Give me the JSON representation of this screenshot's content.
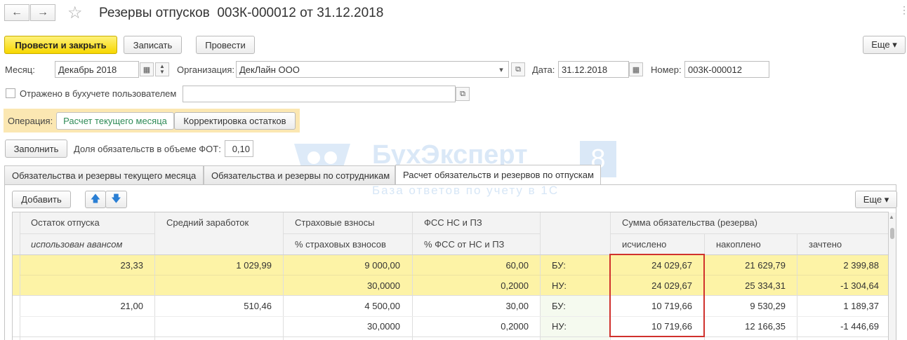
{
  "window": {
    "title": "Резервы отпусков  003К-000012 от 31.12.2018",
    "back_icon": "←",
    "forward_icon": "→",
    "star_icon": "☆",
    "menu_icon": "⋮"
  },
  "toolbar": {
    "post_close": "Провести и закрыть",
    "save": "Записать",
    "post": "Провести",
    "more": "Еще ▾"
  },
  "form": {
    "month_label": "Месяц:",
    "month_value": "Декабрь 2018",
    "org_label": "Организация:",
    "org_value": "ДекЛайн ООО",
    "date_label": "Дата:",
    "date_value": "31.12.2018",
    "number_label": "Номер:",
    "number_value": "003К-000012",
    "reflected_label": "Отражено в бухучете пользователем",
    "reflected_value": ""
  },
  "operation": {
    "label": "Операция:",
    "opt1": "Расчет текущего месяца",
    "opt2": "Корректировка остатков"
  },
  "fill": {
    "button": "Заполнить",
    "fot_label": "Доля обязательств в объеме ФОТ:",
    "fot_value": "0,10"
  },
  "watermark": {
    "title": "БухЭксперт",
    "sub": "База ответов по учету в 1С",
    "num": "8"
  },
  "tabs": [
    "Обязательства и резервы текущего месяца",
    "Обязательства и резервы по сотрудникам",
    "Расчет обязательств и резервов по отпускам"
  ],
  "table_toolbar": {
    "add": "Добавить",
    "up": "🡅",
    "down": "🡇",
    "more": "Еще ▾"
  },
  "table": {
    "h_row1": [
      "Остаток отпуска",
      "Средний заработок",
      "Страховые взносы",
      "ФСС НС и ПЗ",
      "",
      "Сумма обязательства (резерва)"
    ],
    "h_row2": [
      "использован авансом",
      "",
      "% страховых взносов",
      "% ФСС от НС и ПЗ",
      "",
      "исчислено",
      "накоплено",
      "зачтено"
    ],
    "rows": [
      [
        "23,33",
        "1 029,99",
        "9 000,00",
        "60,00",
        "БУ:",
        "24 029,67",
        "21 629,79",
        "2 399,88"
      ],
      [
        "",
        "",
        "30,0000",
        "0,2000",
        "НУ:",
        "24 029,67",
        "25 334,31",
        "-1 304,64"
      ],
      [
        "21,00",
        "510,46",
        "4 500,00",
        "30,00",
        "БУ:",
        "10 719,66",
        "9 530,29",
        "1 189,37"
      ],
      [
        "",
        "",
        "30,0000",
        "0,2000",
        "НУ:",
        "10 719,66",
        "12 166,35",
        "-1 446,69"
      ]
    ]
  },
  "colors": {
    "primary": "#f7d700",
    "highlight_row": "#fdf3a6",
    "operation_bg": "#fbe7b2",
    "red_box": "#d0312d",
    "selected_op": "#2e8b57"
  }
}
